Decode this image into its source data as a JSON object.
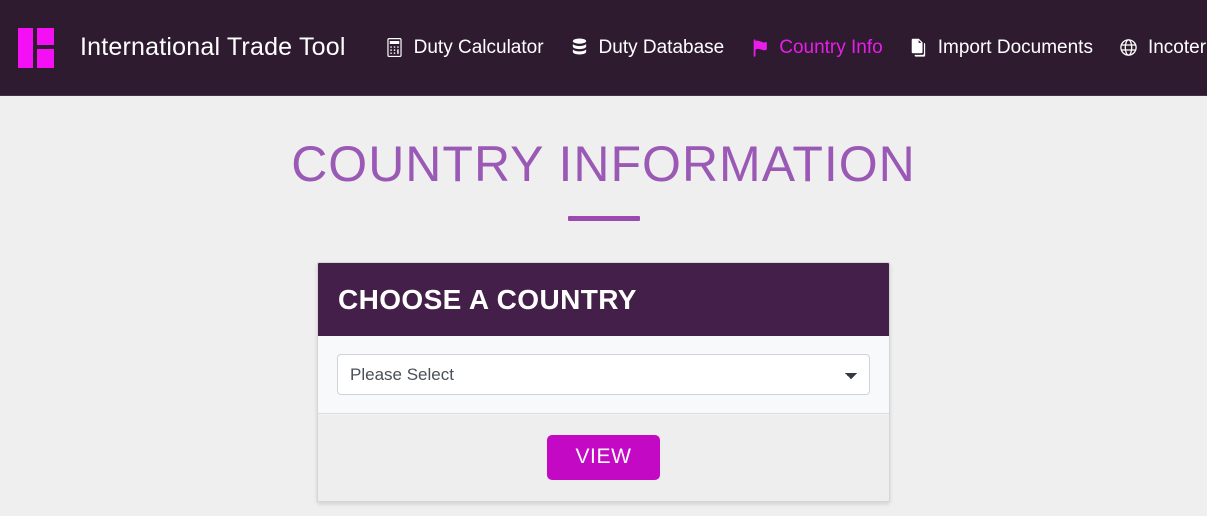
{
  "navbar": {
    "brand": "International Trade Tool",
    "logo_icon": "grid-logo-icon",
    "links": [
      {
        "label": "Duty Calculator",
        "icon": "calculator-icon",
        "active": false
      },
      {
        "label": "Duty Database",
        "icon": "database-icon",
        "active": false
      },
      {
        "label": "Country Info",
        "icon": "flag-icon",
        "active": true
      },
      {
        "label": "Import Documents",
        "icon": "documents-icon",
        "active": false
      },
      {
        "label": "Incoterms",
        "icon": "globe-icon",
        "active": false
      }
    ],
    "settings": {
      "icon": "gear-icon",
      "caret_icon": "caret-down-icon"
    },
    "background_color": "#2e1b30",
    "active_link_color": "#e81ee8"
  },
  "page": {
    "title": "COUNTRY INFORMATION",
    "title_color": "#9b59b6",
    "background_color": "#efefef"
  },
  "card": {
    "header_title": "CHOOSE A COUNTRY",
    "header_color": "#441f4a",
    "select": {
      "name": "country-select",
      "selected_value": "Please Select",
      "options": [
        "Please Select"
      ],
      "chevron_icon": "chevron-down-icon"
    },
    "footer": {
      "view_label": "VIEW",
      "view_color": "#c409c4"
    }
  }
}
